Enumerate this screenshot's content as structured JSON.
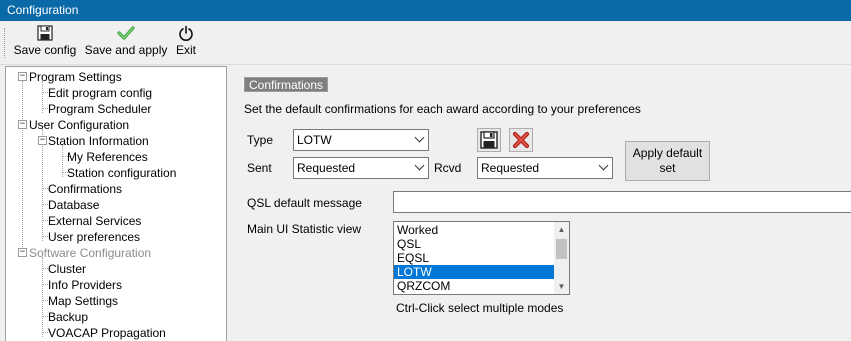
{
  "window": {
    "title": "Configuration"
  },
  "toolbar": {
    "save_config": "Save config",
    "save_apply": "Save and apply",
    "exit": "Exit"
  },
  "tree": {
    "program_settings": "Program Settings",
    "edit_program_config": "Edit program config",
    "program_scheduler": "Program Scheduler",
    "user_configuration": "User Configuration",
    "station_information": "Station Information",
    "my_references": "My References",
    "station_configuration": "Station configuration",
    "confirmations": "Confirmations",
    "database": "Database",
    "external_services": "External Services",
    "user_preferences": "User preferences",
    "software_configuration": "Software Configuration",
    "cluster": "Cluster",
    "info_providers": "Info Providers",
    "map_settings": "Map Settings",
    "backup": "Backup",
    "voacap_propagation": "VOACAP Propagation"
  },
  "confirmations": {
    "section_title": "Confirmations",
    "description": "Set the default confirmations for each award according to your preferences",
    "type_label": "Type",
    "type_value": "LOTW",
    "sent_label": "Sent",
    "sent_value": "Requested",
    "rcvd_label": "Rcvd",
    "rcvd_value": "Requested",
    "apply_default_line1": "Apply default",
    "apply_default_line2": "set",
    "qsl_default_label": "QSL default message",
    "qsl_default_value": "",
    "main_ui_label": "Main UI Statistic view",
    "stat_options": [
      "Worked",
      "QSL",
      "EQSL",
      "LOTW",
      "QRZCOM"
    ],
    "selected_option": "LOTW",
    "hint": "Ctrl-Click select multiple modes"
  }
}
